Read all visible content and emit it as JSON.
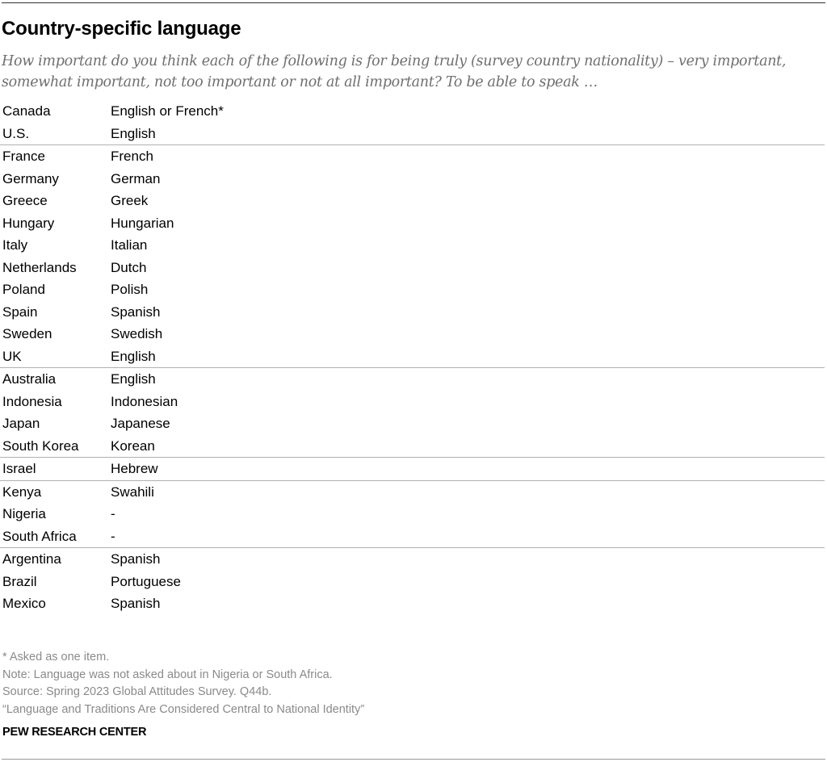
{
  "title": "Country-specific language",
  "subtitle": "How important do you think each of the following is for being truly (survey country nationality) – very important, somewhat important, not too important or not at all important?  To be able to speak …",
  "groups": [
    {
      "rows": [
        {
          "country": "Canada",
          "language": "English or French*"
        },
        {
          "country": "U.S.",
          "language": "English"
        }
      ]
    },
    {
      "rows": [
        {
          "country": "France",
          "language": "French"
        },
        {
          "country": "Germany",
          "language": "German"
        },
        {
          "country": "Greece",
          "language": "Greek"
        },
        {
          "country": "Hungary",
          "language": "Hungarian"
        },
        {
          "country": "Italy",
          "language": "Italian"
        },
        {
          "country": "Netherlands",
          "language": "Dutch"
        },
        {
          "country": "Poland",
          "language": "Polish"
        },
        {
          "country": "Spain",
          "language": "Spanish"
        },
        {
          "country": "Sweden",
          "language": "Swedish"
        },
        {
          "country": "UK",
          "language": "English"
        }
      ]
    },
    {
      "rows": [
        {
          "country": "Australia",
          "language": "English"
        },
        {
          "country": "Indonesia",
          "language": "Indonesian"
        },
        {
          "country": "Japan",
          "language": "Japanese"
        },
        {
          "country": "South Korea",
          "language": "Korean"
        }
      ]
    },
    {
      "rows": [
        {
          "country": "Israel",
          "language": "Hebrew"
        }
      ]
    },
    {
      "rows": [
        {
          "country": "Kenya",
          "language": "Swahili"
        },
        {
          "country": "Nigeria",
          "language": "-"
        },
        {
          "country": "South Africa",
          "language": "-"
        }
      ]
    },
    {
      "rows": [
        {
          "country": "Argentina",
          "language": "Spanish"
        },
        {
          "country": "Brazil",
          "language": "Portuguese"
        },
        {
          "country": "Mexico",
          "language": "Spanish"
        }
      ]
    }
  ],
  "notes": [
    "* Asked as one item.",
    "Note: Language was not asked about in Nigeria or South Africa.",
    "Source: Spring 2023 Global Attitudes Survey. Q44b.",
    "“Language and Traditions Are Considered Central to National Identity”"
  ],
  "brand": "PEW RESEARCH CENTER"
}
